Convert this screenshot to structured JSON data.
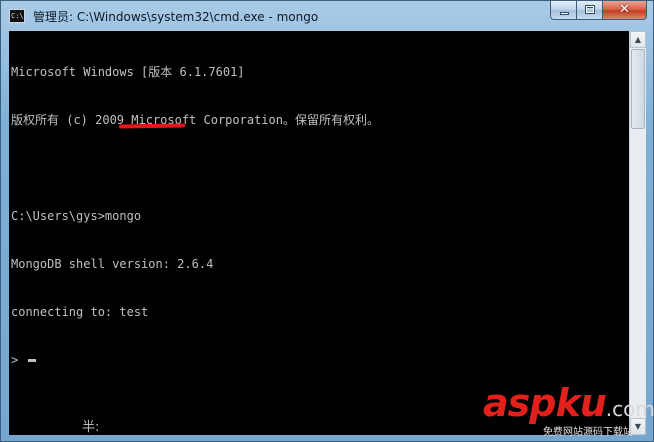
{
  "window": {
    "title": "管理员: C:\\Windows\\system32\\cmd.exe - mongo",
    "icon_label": "C:\\"
  },
  "console": {
    "lines": [
      "Microsoft Windows [版本 6.1.7601]",
      "版权所有 (c) 2009 Microsoft Corporation。保留所有权利。",
      "",
      "C:\\Users\\gys>mongo",
      "MongoDB shell version: 2.6.4",
      "connecting to: test",
      ">"
    ],
    "ime_status": "半:"
  },
  "controls": {
    "minimize": "minimize",
    "maximize": "maximize",
    "close": "✕"
  },
  "watermark": {
    "brand": "aspku",
    "tld": ".com",
    "slogan": "免费网站源码下载站!"
  },
  "colors": {
    "console_bg": "#000000",
    "console_text": "#c0c0c0",
    "annotation_red": "#e8141b",
    "brand_red": "#e3201b"
  }
}
